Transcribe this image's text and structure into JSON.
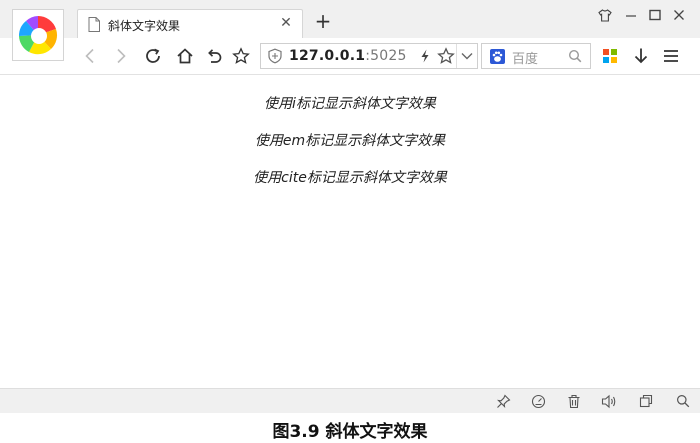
{
  "tab": {
    "title": "斜体文字效果"
  },
  "address_bar": {
    "host": "127.0.0.1",
    "port": ":5025"
  },
  "search_box": {
    "placeholder": "百度"
  },
  "content": {
    "lines": [
      "使用i标记显示斜体文字效果",
      "使用em标记显示斜体文字效果",
      "使用cite标记显示斜体文字效果"
    ]
  },
  "caption": "图3.9  斜体文字效果",
  "icons": {
    "logo": "browser-logo-icon",
    "tab_page": "page-icon",
    "tab_close": "close-icon",
    "new_tab": "plus-icon",
    "skin": "shirt-icon",
    "minimize": "minimize-icon",
    "maximize": "maximize-icon",
    "close_window": "close-icon",
    "back": "back-arrow-icon",
    "forward": "forward-arrow-icon",
    "reload": "reload-icon",
    "home": "home-icon",
    "undo": "undo-icon",
    "favorite": "star-icon",
    "security": "shield-icon",
    "quick": "lightning-icon",
    "bookmark": "star-icon",
    "dropdown": "chevron-down-icon",
    "engine": "baidu-paw-icon",
    "search": "search-icon",
    "apps": "apps-grid-icon",
    "download": "download-icon",
    "menu": "menu-icon",
    "pin": "pin-icon",
    "speed": "speed-icon",
    "trash": "trash-icon",
    "sound": "speaker-icon",
    "window": "window-icon",
    "zoom": "search-icon"
  },
  "colors": {
    "accent": "#3b6fd8",
    "text": "#222222",
    "chrome": "#f0f0f0"
  }
}
